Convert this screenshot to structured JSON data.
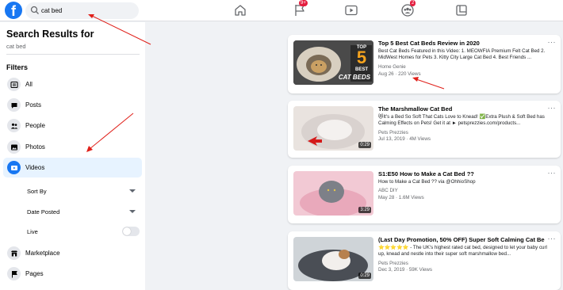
{
  "topbar": {
    "logo": "f",
    "search_value": "cat bed",
    "nav": [
      {
        "icon": "home-icon"
      },
      {
        "icon": "flag-icon",
        "badge": "9+"
      },
      {
        "icon": "watch-icon"
      },
      {
        "icon": "groups-icon",
        "badge": "2"
      },
      {
        "icon": "gaming-icon"
      }
    ]
  },
  "sidebar": {
    "title": "Search Results for",
    "query": "cat bed",
    "filters_label": "Filters",
    "items": [
      {
        "label": "All",
        "icon": "all-icon"
      },
      {
        "label": "Posts",
        "icon": "posts-icon"
      },
      {
        "label": "People",
        "icon": "people-icon"
      },
      {
        "label": "Photos",
        "icon": "photos-icon"
      },
      {
        "label": "Videos",
        "icon": "videos-icon"
      }
    ],
    "sub": [
      {
        "label": "Sort By"
      },
      {
        "label": "Date Posted"
      },
      {
        "label": "Live"
      }
    ],
    "bottom": [
      {
        "label": "Marketplace",
        "icon": "marketplace-icon"
      },
      {
        "label": "Pages",
        "icon": "pages-icon"
      }
    ]
  },
  "results": [
    {
      "title": "Top 5 Best Cat Beds Review in 2020",
      "desc": "Best Cat Beds Featured in this Video: 1. MEOWFIA Premium Felt Cat Bed 2. MidWest Homes for Pets 3. Kitty City Large Cat Bed 4. Best Friends ...",
      "channel": "Home Genie",
      "meta": "Aug 26 · 220 Views",
      "thumb_text_top": "TOP",
      "thumb_text_num": "5",
      "thumb_text_best": "BEST",
      "thumb_text_bottom": "CAT BEDS",
      "duration": ""
    },
    {
      "title": "The Marshmallow Cat Bed",
      "desc": "😻It's a Bed So Soft That Cats Love to Knead! ✅Extra Plush & Soft Bed has Calming Effects on Pets! Get it at ► petsprezzies.com/products...",
      "channel": "Pets Prezzies",
      "meta": "Jul 13, 2019 · 4M Views",
      "duration": "0:29"
    },
    {
      "title": "S1:E50 How to Make a Cat Bed ??",
      "desc": "How to Make a Cat Bed ?? via @OhhioShop",
      "channel": "ABC DIY",
      "meta": "May 28 · 1.6M Views",
      "duration": "3:29"
    },
    {
      "title": "(Last Day Promotion, 50% OFF) Super Soft Calming Cat Bed",
      "desc": "⭐⭐⭐⭐⭐ - The UK's highest rated cat bed, designed to let your baby curl up, knead and nestle into their super soft marshmallow bed...",
      "channel": "Pets Prezzies",
      "meta": "Dec 3, 2019 · 59K Views",
      "duration": "0:29"
    }
  ],
  "more_label": "···",
  "colors": {
    "accent": "#1877f2",
    "badge": "#e41e3f",
    "annotation": "#e0201a"
  }
}
